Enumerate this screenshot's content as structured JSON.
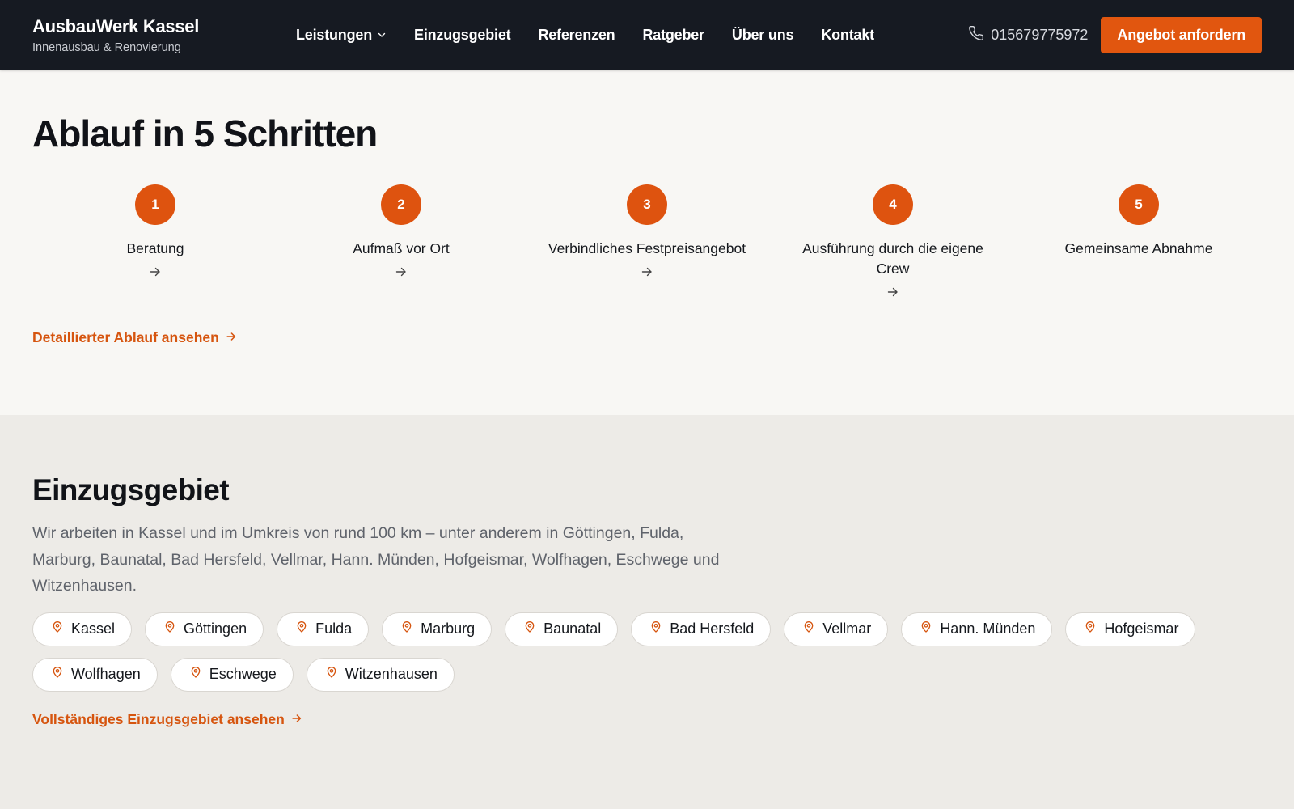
{
  "brand": {
    "name": "AusbauWerk Kassel",
    "tagline": "Innenausbau & Renovierung"
  },
  "nav": {
    "items": [
      {
        "label": "Leistungen",
        "has_dropdown": true
      },
      {
        "label": "Einzugsgebiet"
      },
      {
        "label": "Referenzen"
      },
      {
        "label": "Ratgeber"
      },
      {
        "label": "Über uns"
      },
      {
        "label": "Kontakt"
      }
    ],
    "phone": "015679775972",
    "cta_label": "Angebot anfordern"
  },
  "steps_section": {
    "title": "Ablauf in 5 Schritten",
    "steps": [
      {
        "number": "1",
        "label": "Beratung",
        "has_arrow": true
      },
      {
        "number": "2",
        "label": "Aufmaß vor Ort",
        "has_arrow": true
      },
      {
        "number": "3",
        "label": "Verbindliches Festpreisangebot",
        "has_arrow": true
      },
      {
        "number": "4",
        "label": "Ausführung durch die eigene Crew",
        "has_arrow": true
      },
      {
        "number": "5",
        "label": "Gemeinsame Abnahme",
        "has_arrow": false
      }
    ],
    "link_label": "Detaillierter Ablauf ansehen"
  },
  "region_section": {
    "title": "Einzugsgebiet",
    "text": "Wir arbeiten in Kassel und im Umkreis von rund 100 km – unter anderem in Göttingen, Fulda, Marburg, Baunatal, Bad Hersfeld, Vellmar, Hann. Münden, Hofgeismar, Wolfhagen, Eschwege und Witzenhausen.",
    "cities": [
      "Kassel",
      "Göttingen",
      "Fulda",
      "Marburg",
      "Baunatal",
      "Bad Hersfeld",
      "Vellmar",
      "Hann. Münden",
      "Hofgeismar",
      "Wolfhagen",
      "Eschwege",
      "Witzenhausen"
    ],
    "link_label": "Vollständiges Einzugsgebiet ansehen"
  },
  "colors": {
    "accent": "#e1560f",
    "header_bg": "#161a22",
    "page_bg": "#f8f7f4",
    "region_bg": "#edebe7"
  },
  "icons": {
    "phone": "phone-icon",
    "chevron": "chevron-down-icon",
    "arrow": "arrow-right-icon",
    "pin": "map-pin-icon"
  }
}
